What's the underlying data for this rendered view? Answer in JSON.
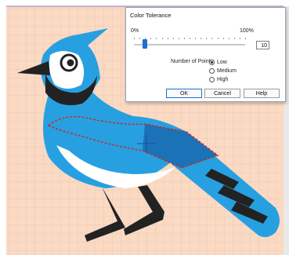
{
  "dialog": {
    "title": "Color Tolerance",
    "slider_min_label": "0%",
    "slider_max_label": "100%",
    "tolerance_value": "10",
    "tolerance_fraction": 0.1,
    "number_of_points_label": "Number of Points:",
    "options": [
      {
        "label": "Low",
        "selected": true
      },
      {
        "label": "Medium",
        "selected": false
      },
      {
        "label": "High",
        "selected": false
      }
    ],
    "ok_label": "OK",
    "cancel_label": "Cancel",
    "help_label": "Help"
  },
  "colors": {
    "background": "#fcd9c1",
    "grid": "#c6c4cf",
    "bird_blue": "#27a0e1",
    "bird_dark_blue": "#1b72b6",
    "bird_black": "#222222",
    "selection": "#c0302a",
    "accent": "#1e6fcf"
  }
}
